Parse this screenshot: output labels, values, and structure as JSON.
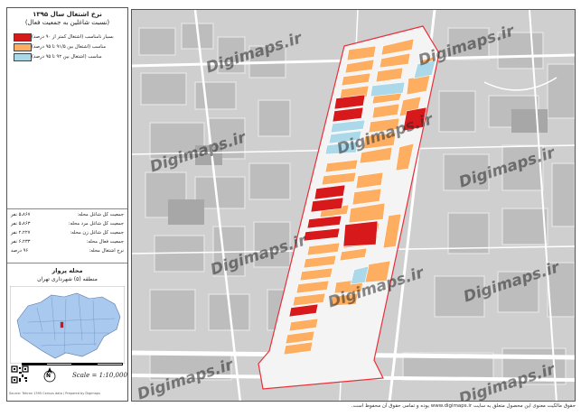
{
  "sidebar": {
    "title_line1": "نرخ اشتغال سال ۱۳۹۵",
    "title_line2": "(نسبت شاغلین به جمعیت فعال)",
    "legend": [
      {
        "label": "بسیار نامناسب (اشتغال کمتر از ۹۰ درصد)",
        "color": "#d7191c"
      },
      {
        "label": "مناسب (اشتغال بین ۹۱/۵ تا ۹۵ درصد)",
        "color": "#fdae61"
      },
      {
        "label": "مناسب (اشتغال بین ۹۲ تا ۹۵ درصد)",
        "color": "#abd9e9"
      }
    ],
    "stats": [
      {
        "label": "جمعیت کل شاغل محله:",
        "value": "۵،۸۶۷ نفر"
      },
      {
        "label": "جمعیت کل شاغل مرد محله:",
        "value": "۵،۸۶۳ نفر"
      },
      {
        "label": "جمعیت کل شاغل زن محله:",
        "value": "۲،۲۲۷ نفر"
      },
      {
        "label": "جمعیت فعال محله:",
        "value": "۶،۲۳۳ نفر"
      },
      {
        "label": "نرخ اشتغال محله:",
        "value": "۹۶ درصد"
      }
    ],
    "neighborhood": "محله پرواز",
    "district": "منطقه (۵) شهرداری تهران",
    "scale": "Scale = 1:10,000",
    "north": "N",
    "credit": "Source: Tehran 1395 Census data / Prepared by Digimaps"
  },
  "map": {
    "watermark": "Digimaps.ir",
    "colors": {
      "red": "#d7191c",
      "orange": "#fdae61",
      "blue": "#abd9e9",
      "boundary": "#e8303a",
      "base": "#cfcfcf"
    }
  },
  "footer": {
    "text": "حقوق مالکیت معنوی این محصول متعلق به سایت www.digimaps.ir بوده و تمامی حقوق آن محفوظ است."
  }
}
